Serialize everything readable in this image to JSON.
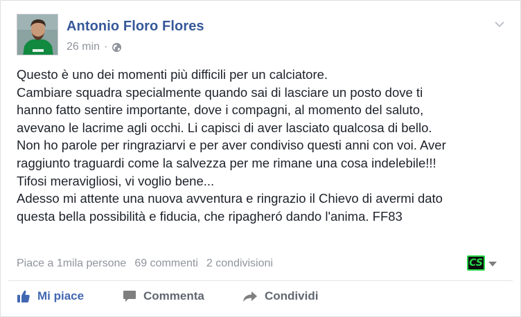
{
  "post": {
    "author": "Antonio Floro Flores",
    "time": "26 min",
    "separator": "·",
    "privacy_icon": "globe-icon",
    "lines": [
      "Questo è uno dei momenti più difficili per un calciatore.",
      "Cambiare squadra specialmente quando sai di lasciare un posto dove ti",
      "hanno fatto sentire importante, dove i compagni, al momento del saluto,",
      "avevano le lacrime agli occhi. Li capisci di aver lasciato qualcosa di bello.",
      "Non ho parole per ringraziarvi e per aver condiviso questi anni con voi. Aver",
      "raggiunto traguardi come la salvezza per me rimane una cosa indelebile!!!",
      "Tifosi meravigliosi, vi voglio bene...",
      "Adesso mi attente una nuova avventura e ringrazio il Chievo di avermi dato",
      "questa bella possibilità e fiducia, che ripagheró dando l'anima. FF83"
    ]
  },
  "stats": {
    "likes": "Piace a 1mila persone",
    "comments": "69 commenti",
    "shares": "2 condivisioni",
    "badge": "CS"
  },
  "actions": {
    "like": "Mi piace",
    "comment": "Commenta",
    "share": "Condividi"
  },
  "colors": {
    "link": "#365899",
    "like_blue": "#4267b2",
    "meta_gray": "#90949c",
    "text": "#1d2129",
    "badge_green": "#27d64a"
  }
}
